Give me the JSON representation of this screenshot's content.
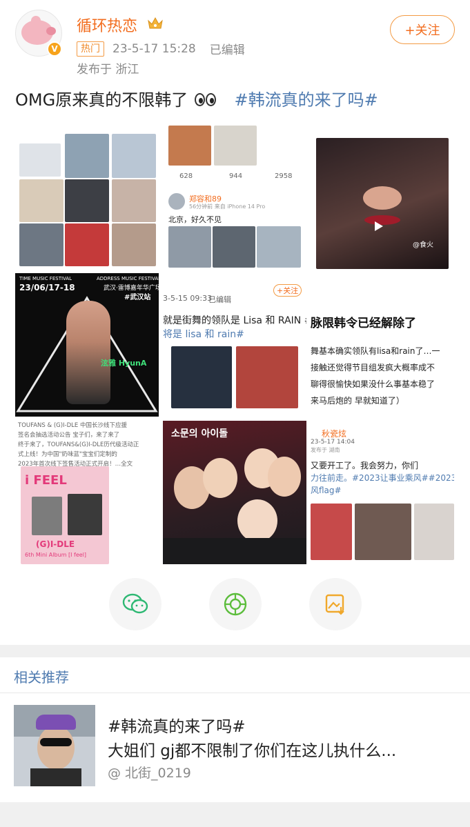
{
  "post": {
    "author": "循环热恋",
    "hot_label": "热门",
    "timestamp": "23-5-17 15:28",
    "edited_label": "已编辑",
    "location": "发布于 浙江",
    "follow_label": "+关注",
    "text": "OMG原来真的不限韩了",
    "hashtag": "#韩流真的来了吗#"
  },
  "images": {
    "c2": {
      "likes": "628",
      "comments": "944",
      "reposts": "2958",
      "user": "郑容和89",
      "source": "56分钟前 来自 iPhone 14 Pro",
      "text": "北京，好久不见"
    },
    "c3": {
      "caption": "@食火"
    },
    "c4": {
      "festival": "TIME MUSIC FESTIVAL",
      "date": "23/06/17-18",
      "brand": "ADDRESS MUSIC FESTIVAL",
      "venue": "武汉·雷博嘉年华广场",
      "city": "#武汉站",
      "name_tag": "泫雅 HyunA"
    },
    "c5": {
      "date": "3-5-15 09:33",
      "edited": "已编辑",
      "follow": "+关注",
      "line1": "就是街舞的领队是 Lisa 和 RAIN #",
      "line2": "将是 lisa 和 rain#"
    },
    "c6": {
      "headline": "脉限韩令已经解除了",
      "line1": "舞基本确实领队有lisa和rain了…一",
      "line2": "接触还觉得节目组发疯大概率成不",
      "line3": "聊得很愉快如果没什么事基本稳了",
      "line4": "来马后炮的 早就知道了）"
    },
    "c7": {
      "line1": "TOUFANS & (G)I-DLE 中国长沙线下应援",
      "line2": "签名会抽选活动公告 宝子们，来了来了",
      "line3": "终于来了，TOUFANS&(G)I-DLE历代级活动正",
      "line4": "式上线！为中国\"奶味蓝\"宝宝们定制的",
      "line5": "2023年首次线下签售活动正式开启！…全文",
      "album_title": "i FEEL",
      "album_artist": "(G)I-DLE",
      "album_sub": "6th Mini Album [I feel]"
    },
    "c8": {
      "overlay": "소문의 아이돌"
    },
    "c9": {
      "user": "秋瓷炫",
      "date": "23-5-17 14:04",
      "location": "发布于 湖南",
      "line1": "又要开工了。我会努力，你们",
      "line2": "力往前走。#2023让事业乘风##2023",
      "line3": "风flag#"
    }
  },
  "share": {
    "wechat_icon": "wechat-icon",
    "moments_icon": "moments-icon",
    "save_icon": "save-image-icon"
  },
  "related": {
    "title": "相关推荐",
    "item_hashtag": "#韩流真的来了吗#",
    "item_text": "大姐们 gj都不限制了你们在这儿执什么...",
    "item_author": "@ 北街_0219"
  },
  "colors": {
    "accent_orange": "#f26d1f",
    "link_blue": "#4f7bb0"
  }
}
